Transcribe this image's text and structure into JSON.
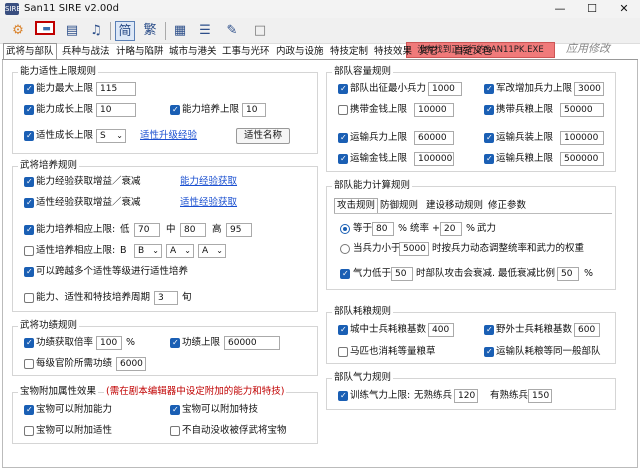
{
  "window": {
    "title": "San11 SIRE v2.00d",
    "app_icon": "SIRE",
    "min": "—",
    "max": "☐",
    "close": "✕"
  },
  "toolbar": {
    "icons": [
      "settings-icon",
      "open-folder-icon",
      "database-icon",
      "music-icon",
      "chinese-simplified-icon",
      "chinese-traditional-icon",
      "table-icon",
      "list-icon",
      "edit-icon",
      "square-icon"
    ],
    "simplified": "简",
    "traditional": "繁",
    "status": "没有找到正运行的SAN11PK.EXE",
    "brand": "应用修改"
  },
  "tabs": [
    "武将与部队",
    "兵种与战法",
    "计略与陷阱",
    "城市与港关",
    "工事与光环",
    "内政与设施",
    "特技定制",
    "特技效果",
    "其它",
    "自定义包"
  ],
  "left": {
    "g1": {
      "title": "能力适性上限规则",
      "ability_max_label": "能力最大上限",
      "ability_max": "115",
      "growth_limit_label": "能力成长上限",
      "growth_limit": "10",
      "train_limit_label": "能力培养上限",
      "train_limit": "10",
      "apt_growth_label": "适性成长上限",
      "apt_growth": "S",
      "apt_link": "适性升级经验",
      "apt_name_btn": "适性名称"
    },
    "g2": {
      "title": "武将培养规则",
      "exp_gain_label": "能力经验获取增益／衰减",
      "exp_gain_link": "能力经验获取",
      "apt_exp_label": "适性经验获取增益／衰减",
      "apt_exp_link": "适性经验获取",
      "train_rel_label": "能力培养相应上限:",
      "low_label": "低",
      "low": "70",
      "mid_label": "中",
      "mid": "80",
      "high_label": "高",
      "high": "95",
      "apt_rel_label": "适性培养相应上限:",
      "b1": "B",
      "b2": "B",
      "a": "A",
      "cross_label": "可以跨越多个适性等级进行适性培养",
      "cycle_label": "能力、适性和特技培养周期",
      "cycle": "3",
      "cycle_unit": "旬"
    },
    "g3": {
      "title": "武将功绩规则",
      "merit_rate_label": "功绩获取倍率",
      "merit_rate": "100",
      "merit_rate_unit": "%",
      "merit_max_label": "功绩上限",
      "merit_max": "60000",
      "per_rank_label": "每级官阶所需功绩",
      "per_rank": "6000"
    },
    "g4": {
      "title": "宝物附加属性效果",
      "note": "(需在剧本编辑器中设定附加的能力和特技)",
      "ability_label": "宝物可以附加能力",
      "skill_label": "宝物可以附加特技",
      "apt_label": "宝物可以附加适性",
      "no_confiscate_label": "不自动没收被俘武将宝物"
    }
  },
  "right": {
    "g1": {
      "title": "部队容量规则",
      "min_soldier_label": "部队出征最小兵力",
      "min_soldier": "1000",
      "reform_label": "军改增加兵力上限",
      "reform": "3000",
      "gold_label": "携带金钱上限",
      "gold": "10000",
      "food_label": "携带兵粮上限",
      "food": "50000",
      "transport_soldier_label": "运输兵力上限",
      "transport_soldier": "60000",
      "transport_weapon_label": "运输兵装上限",
      "transport_weapon": "100000",
      "transport_gold_label": "运输金钱上限",
      "transport_gold": "100000",
      "transport_food_label": "运输兵粮上限",
      "transport_food": "500000"
    },
    "g2": {
      "title": "部队能力计算规则",
      "subtabs": [
        "攻击规则",
        "防御规则",
        "建设移动规则",
        "修正参数"
      ],
      "equal_label": "等于",
      "equal_val1": "80",
      "pct1": "%",
      "lead_label": "统率 +",
      "equal_val2": "20",
      "pct2": "%",
      "force_label": "武力",
      "lower_label": "当兵力小于",
      "lower_val": "5000",
      "lower_desc": "时按兵力动态调整统率和武力的权重",
      "morale_label": "气力低于",
      "morale_val": "50",
      "morale_desc": "时部队攻击会衰减. 最低衰减比例",
      "morale_pct": "50",
      "morale_unit": "%"
    },
    "g3": {
      "title": "部队耗粮规则",
      "city_label": "城中士兵耗粮基数",
      "city": "400",
      "field_label": "野外士兵耗粮基数",
      "field": "600",
      "horse_label": "马匹也消耗等量粮草",
      "transport_label": "运输队耗粮等同一般部队"
    },
    "g4": {
      "title": "部队气力规则",
      "train_label": "训练气力上限:",
      "no_elite_label": "无熟练兵",
      "no_elite": "120",
      "elite_label": "有熟练兵",
      "elite": "150"
    }
  }
}
